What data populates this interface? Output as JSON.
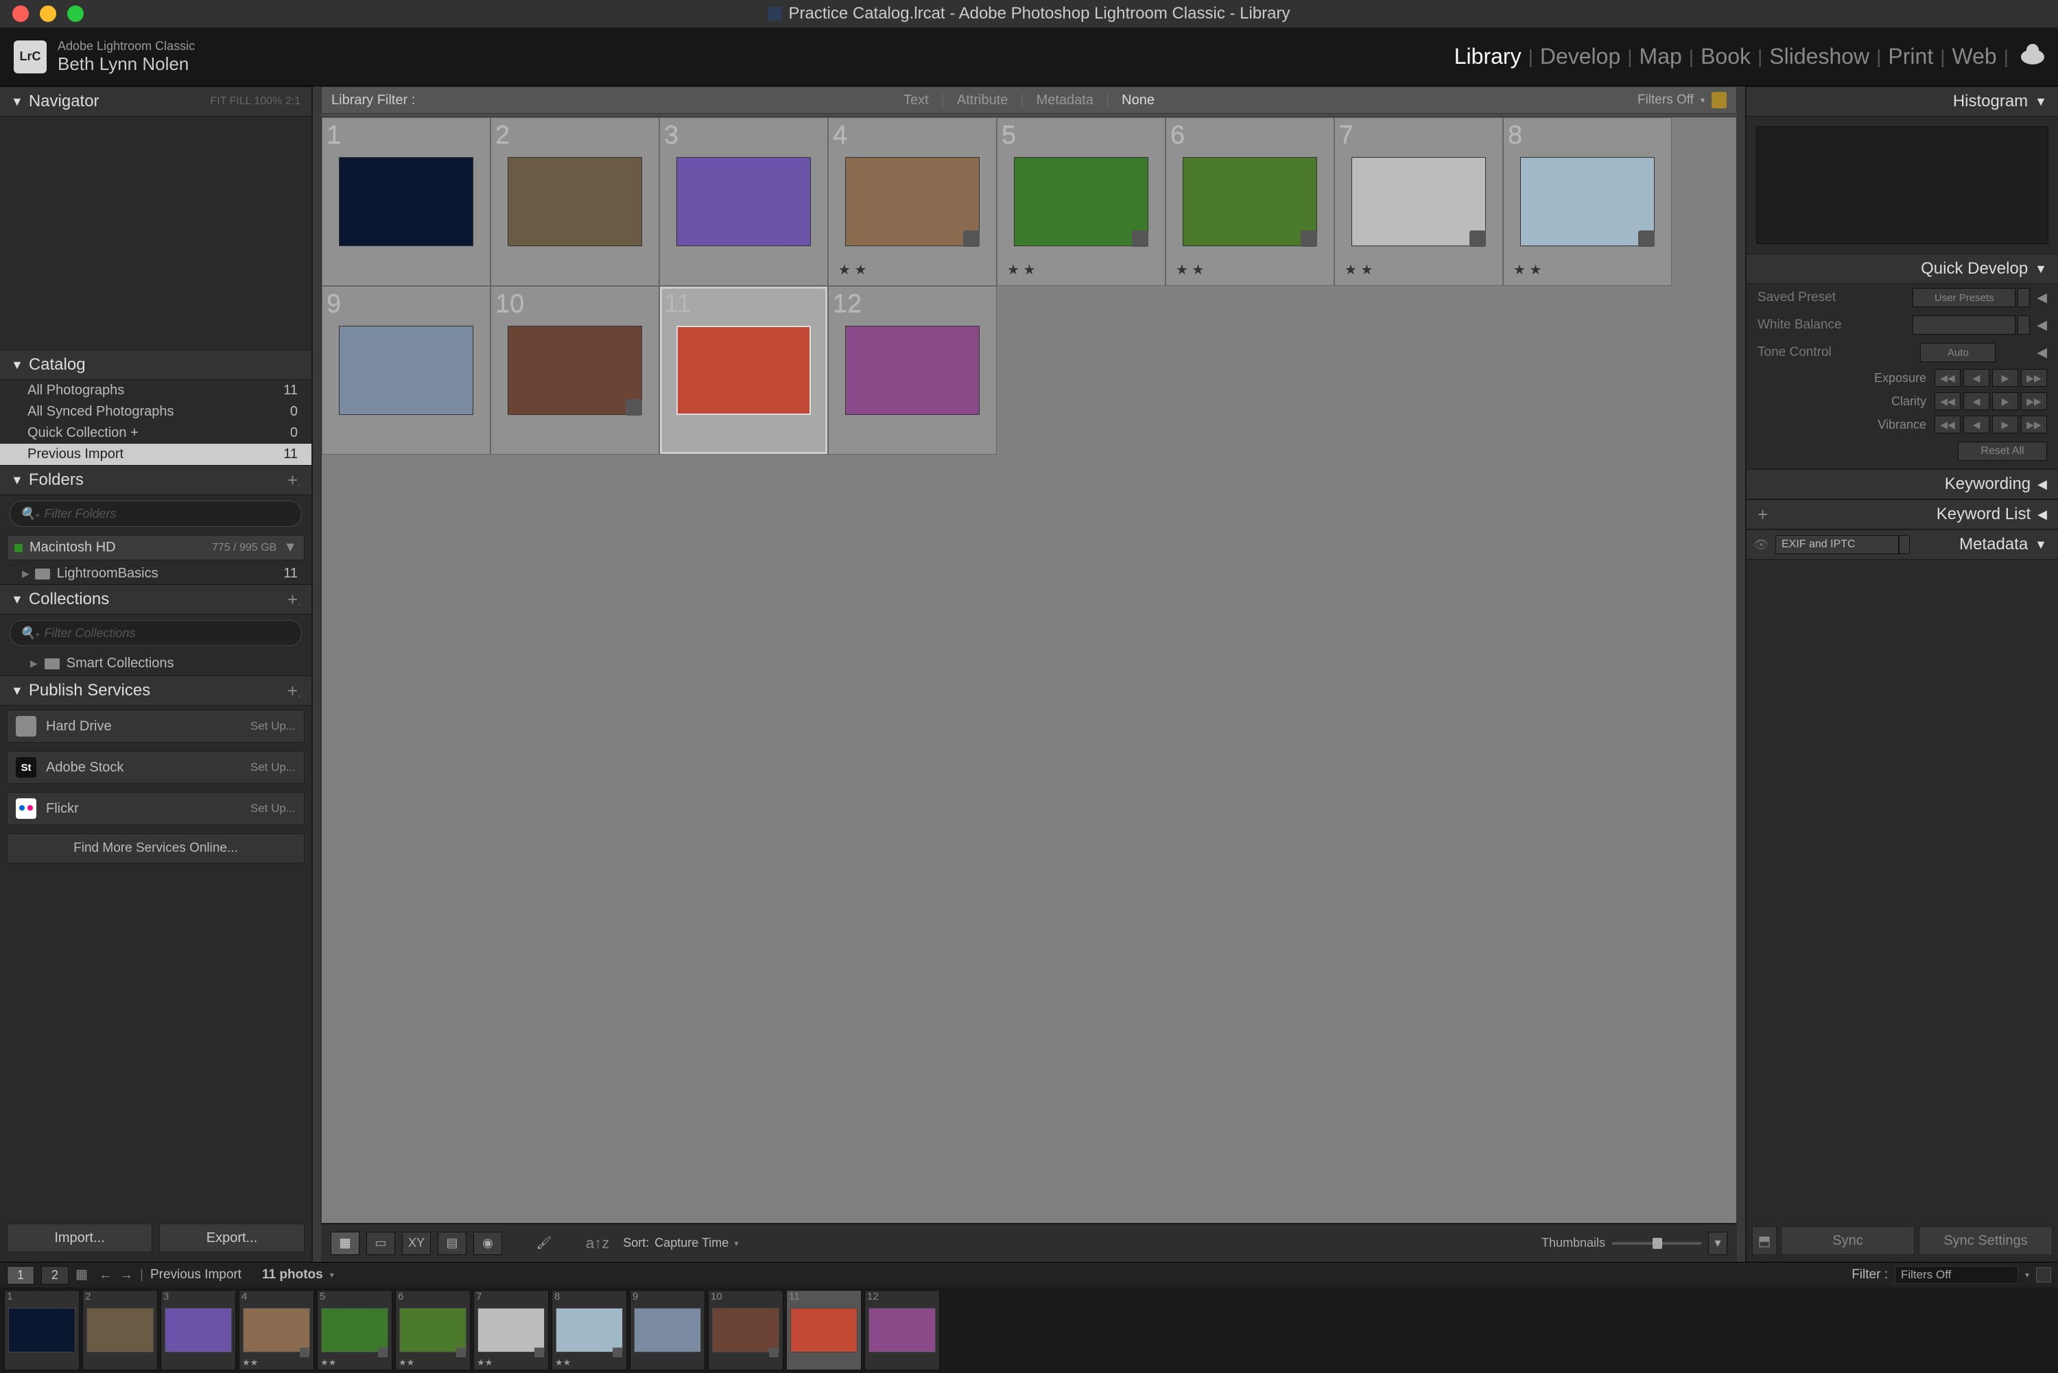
{
  "window": {
    "title": "Practice Catalog.lrcat - Adobe Photoshop Lightroom Classic - Library"
  },
  "brand": {
    "logo_text": "LrC",
    "app": "Adobe Lightroom Classic",
    "user": "Beth Lynn Nolen"
  },
  "modules": [
    {
      "label": "Library",
      "active": true
    },
    {
      "label": "Develop",
      "active": false
    },
    {
      "label": "Map",
      "active": false
    },
    {
      "label": "Book",
      "active": false
    },
    {
      "label": "Slideshow",
      "active": false
    },
    {
      "label": "Print",
      "active": false
    },
    {
      "label": "Web",
      "active": false
    }
  ],
  "navigator": {
    "title": "Navigator",
    "zoom_labels": "FIT    FILL    100%   2:1"
  },
  "catalog": {
    "title": "Catalog",
    "items": [
      {
        "label": "All Photographs",
        "count": "11",
        "selected": false
      },
      {
        "label": "All Synced Photographs",
        "count": "0",
        "selected": false
      },
      {
        "label": "Quick Collection  +",
        "count": "0",
        "selected": false
      },
      {
        "label": "Previous Import",
        "count": "11",
        "selected": true
      }
    ]
  },
  "folders": {
    "title": "Folders",
    "search_placeholder": "Filter Folders",
    "drive": {
      "name": "Macintosh HD",
      "stats": "775 / 995 GB"
    },
    "subfolders": [
      {
        "name": "LightroomBasics",
        "count": "11"
      }
    ]
  },
  "collections": {
    "title": "Collections",
    "search_placeholder": "Filter Collections",
    "items": [
      {
        "name": "Smart Collections"
      }
    ]
  },
  "publish": {
    "title": "Publish Services",
    "items": [
      {
        "name": "Hard Drive",
        "setup": "Set Up...",
        "icon_bg": "#8a8a8a"
      },
      {
        "name": "Adobe Stock",
        "setup": "Set Up...",
        "icon_bg": "#111",
        "icon_text": "St",
        "icon_fg": "#fff"
      },
      {
        "name": "Flickr",
        "setup": "Set Up...",
        "icon_bg": "#fff"
      }
    ],
    "findmore": "Find More Services Online..."
  },
  "left_buttons": {
    "import": "Import...",
    "export": "Export..."
  },
  "filterbar": {
    "label": "Library Filter :",
    "tabs": [
      {
        "t": "Text"
      },
      {
        "t": "Attribute"
      },
      {
        "t": "Metadata"
      },
      {
        "t": "None",
        "active": true
      }
    ],
    "filters_off": "Filters Off"
  },
  "grid": [
    {
      "n": "1",
      "bg": "#0a1730"
    },
    {
      "n": "2",
      "bg": "#6b5a44"
    },
    {
      "n": "3",
      "bg": "#6a53a8"
    },
    {
      "n": "4",
      "bg": "#8a6b50",
      "rating": "★ ★",
      "badge": true
    },
    {
      "n": "5",
      "bg": "#3a7a2a",
      "rating": "★ ★",
      "badge": true
    },
    {
      "n": "6",
      "bg": "#4a7a2a",
      "rating": "★ ★",
      "badge": true
    },
    {
      "n": "7",
      "bg": "#bcbcbc",
      "rating": "★ ★",
      "badge": true
    },
    {
      "n": "8",
      "bg": "#a0b8c8",
      "rating": "★ ★",
      "badge": true
    },
    {
      "n": "9",
      "bg": "#7a8aa0"
    },
    {
      "n": "10",
      "bg": "#6b4436",
      "badge": true
    },
    {
      "n": "11",
      "bg": "#c24a34",
      "selected": true
    },
    {
      "n": "12",
      "bg": "#8a4a8a"
    }
  ],
  "grid_actual_count": 12,
  "toolbar": {
    "sort_label": "Sort:",
    "sort_value": "Capture Time",
    "thumbnails_label": "Thumbnails"
  },
  "histogram": {
    "title": "Histogram"
  },
  "quickdev": {
    "title": "Quick Develop",
    "preset_label": "Saved Preset",
    "preset_value": "User Presets",
    "wb_label": "White Balance",
    "wb_value": "",
    "tone_label": "Tone Control",
    "tone_value": "Auto",
    "adjustments": [
      {
        "label": "Exposure"
      },
      {
        "label": "Clarity"
      },
      {
        "label": "Vibrance"
      }
    ],
    "reset": "Reset All"
  },
  "keywording": {
    "title": "Keywording"
  },
  "keywordlist": {
    "title": "Keyword List"
  },
  "metadata": {
    "title": "Metadata",
    "preset": "EXIF and IPTC"
  },
  "right_buttons": {
    "sync": "Sync",
    "syncset": "Sync Settings"
  },
  "filmstrip": {
    "screen1": "1",
    "screen2": "2",
    "breadcrumb": "Previous Import",
    "count": "11 photos",
    "filter_label": "Filter :",
    "filter_value": "Filters Off",
    "items": [
      {
        "n": "1",
        "bg": "#0a1730"
      },
      {
        "n": "2",
        "bg": "#6b5a44"
      },
      {
        "n": "3",
        "bg": "#6a53a8"
      },
      {
        "n": "4",
        "bg": "#8a6b50",
        "rating": "★★",
        "badge": true
      },
      {
        "n": "5",
        "bg": "#3a7a2a",
        "rating": "★★",
        "badge": true
      },
      {
        "n": "6",
        "bg": "#4a7a2a",
        "rating": "★★",
        "badge": true
      },
      {
        "n": "7",
        "bg": "#bcbcbc",
        "rating": "★★",
        "badge": true
      },
      {
        "n": "8",
        "bg": "#a0b8c8",
        "rating": "★★",
        "badge": true
      },
      {
        "n": "9",
        "bg": "#7a8aa0"
      },
      {
        "n": "10",
        "bg": "#6b4436",
        "badge": true
      },
      {
        "n": "11",
        "bg": "#c24a34",
        "selected": true
      },
      {
        "n": "12",
        "bg": "#8a4a8a"
      }
    ]
  }
}
